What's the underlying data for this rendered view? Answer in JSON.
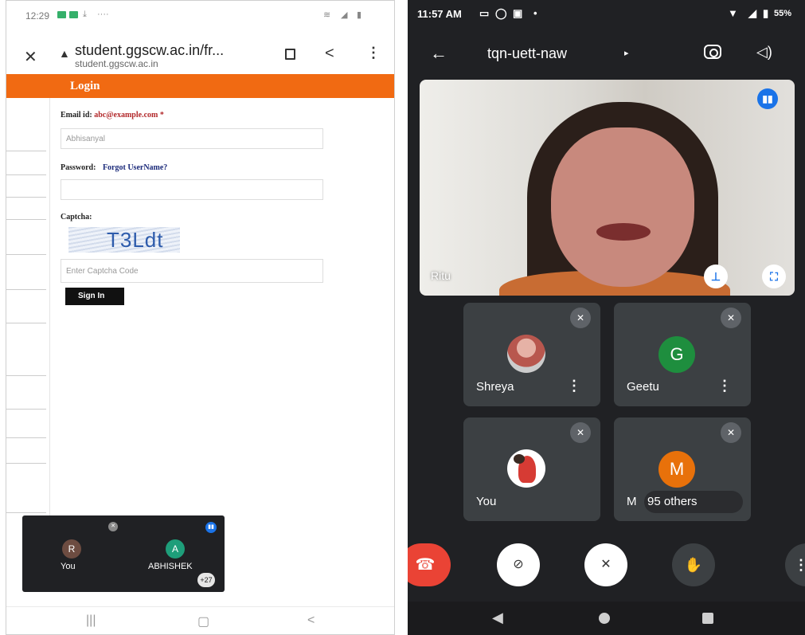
{
  "left_phone": {
    "status": {
      "time": "12:29",
      "dots": "····"
    },
    "browser": {
      "url": "student.ggscw.ac.in/fr...",
      "host": "student.ggscw.ac.in"
    },
    "login": {
      "title": "Login",
      "email_label": "Email id:",
      "email_example": "abc@example.com",
      "required_mark": "*",
      "email_value": "Abhisanyal",
      "password_label": "Password:",
      "forgot_link": "Forgot UserName?",
      "captcha_label": "Captcha:",
      "captcha_text": "T3Ldt",
      "captcha_placeholder": "Enter Captcha Code",
      "signin_label": "Sign In"
    },
    "pip": {
      "you_initial": "R",
      "you_label": "You",
      "other_initial": "A",
      "other_label": "ABHISHEK",
      "count": "+27"
    }
  },
  "right_phone": {
    "status": {
      "time": "11:57 AM",
      "battery": "55%"
    },
    "meeting_code": "tqn-uett-naw",
    "main_speaker": "Ritu",
    "tiles": [
      {
        "name": "Shreya"
      },
      {
        "name": "Geetu",
        "initial": "G",
        "color": "#1e8e3e"
      },
      {
        "name": "You"
      },
      {
        "name": "M",
        "initial": "M",
        "color": "#e8710a",
        "others": "95 others"
      }
    ]
  },
  "colors": {
    "orange_bar": "#f16a12",
    "meet_bg": "#202124",
    "tile_bg": "#3c4043",
    "hangup": "#ea4335",
    "accent_blue": "#1a73e8"
  }
}
